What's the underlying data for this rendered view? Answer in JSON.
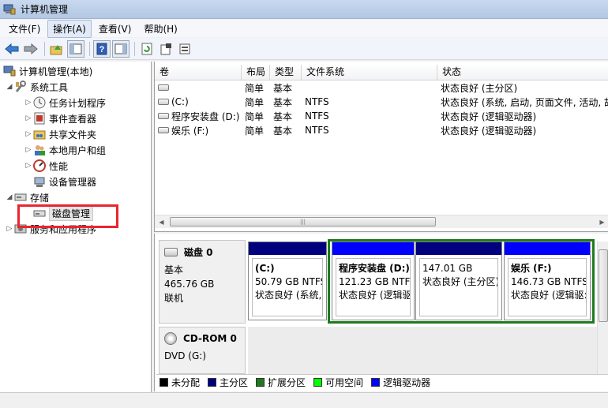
{
  "window": {
    "title": "计算机管理"
  },
  "menu": [
    {
      "label": "文件(F)",
      "active": false
    },
    {
      "label": "操作(A)",
      "active": true
    },
    {
      "label": "查看(V)",
      "active": false
    },
    {
      "label": "帮助(H)",
      "active": false
    }
  ],
  "toolbar": {
    "buttons": [
      "back-icon",
      "forward-icon",
      "up-icon",
      "show-hide-tree-icon",
      "help-icon",
      "action-pane-icon",
      "refresh-icon",
      "properties-icon",
      "export-icon"
    ]
  },
  "tree": {
    "root": "计算机管理(本地)",
    "system_tools": "系统工具",
    "task_scheduler": "任务计划程序",
    "event_viewer": "事件查看器",
    "shared_folders": "共享文件夹",
    "local_users": "本地用户和组",
    "performance": "性能",
    "device_manager": "设备管理器",
    "storage": "存储",
    "disk_management": "磁盘管理",
    "services": "服务和应用程序"
  },
  "volumes": {
    "columns": {
      "volume": "卷",
      "layout": "布局",
      "type": "类型",
      "fs": "文件系统",
      "status": "状态"
    },
    "rows": [
      {
        "volume": "",
        "layout": "简单",
        "type": "基本",
        "fs": "",
        "status": "状态良好 (主分区)"
      },
      {
        "volume": "(C:)",
        "layout": "简单",
        "type": "基本",
        "fs": "NTFS",
        "status": "状态良好 (系统, 启动, 页面文件, 活动, 故"
      },
      {
        "volume": "程序安装盘 (D:)",
        "layout": "简单",
        "type": "基本",
        "fs": "NTFS",
        "status": "状态良好 (逻辑驱动器)"
      },
      {
        "volume": "娱乐 (F:)",
        "layout": "简单",
        "type": "基本",
        "fs": "NTFS",
        "status": "状态良好 (逻辑驱动器)"
      }
    ]
  },
  "disks": {
    "disk0": {
      "name": "磁盘 0",
      "type": "基本",
      "size": "465.76 GB",
      "state": "联机"
    },
    "cdrom0": {
      "name": "CD-ROM 0",
      "type": "DVD (G:)"
    },
    "partitions": [
      {
        "name": "(C:)",
        "size": "50.79 GB NTFS",
        "status": "状态良好 (系统,",
        "color": "#00007f"
      },
      {
        "name": "程序安装盘 (D:)",
        "size": "121.23 GB NTFS",
        "status": "状态良好 (逻辑驱",
        "color": "#0000ff"
      },
      {
        "name": "",
        "size": "147.01 GB",
        "status": "状态良好 (主分区)",
        "color": "#00007f"
      },
      {
        "name": "娱乐 (F:)",
        "size": "146.73 GB NTFS",
        "status": "状态良好 (逻辑驱:",
        "color": "#0000ff"
      }
    ]
  },
  "legend": [
    {
      "label": "未分配",
      "color": "#000000"
    },
    {
      "label": "主分区",
      "color": "#00007f"
    },
    {
      "label": "扩展分区",
      "color": "#1f7a1f"
    },
    {
      "label": "可用空间",
      "color": "#00ff00"
    },
    {
      "label": "逻辑驱动器",
      "color": "#0000ff"
    }
  ]
}
